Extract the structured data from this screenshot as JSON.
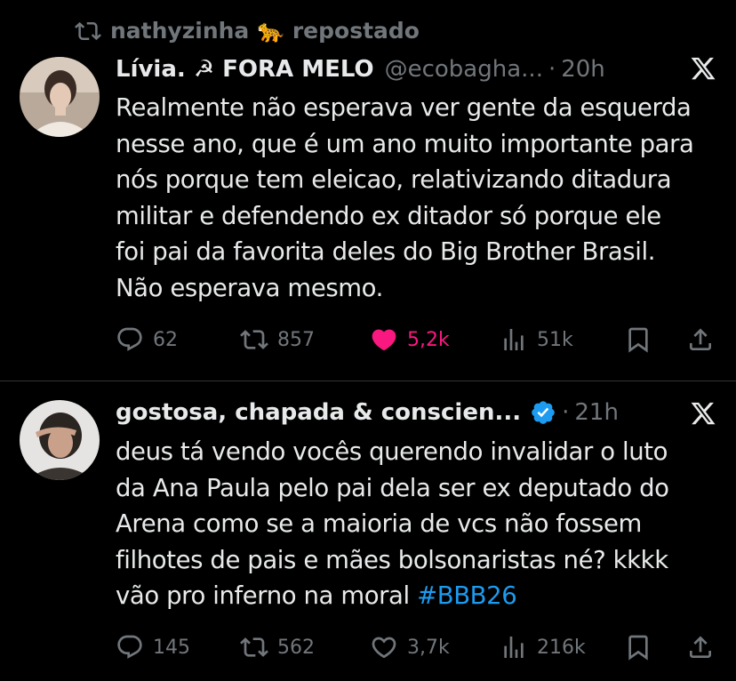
{
  "repost": {
    "label": "nathyzinha 🐆 repostado"
  },
  "tweets": [
    {
      "name": "Lívia. ☭ FORA MELO",
      "handle": "@ecobagha...",
      "dot": "·",
      "time": "20h",
      "text_lines": [
        "Realmente não esperava ver gente da esquerda",
        "nesse ano, que é um ano muito importante para",
        "nós porque tem eleicao, relativizando ditadura",
        "militar e defendendo ex ditador só porque ele",
        "foi pai da favorita deles do Big Brother Brasil.",
        "Não esperava mesmo."
      ],
      "replies": "62",
      "reposts": "857",
      "likes": "5,2k",
      "views": "51k",
      "liked": true
    },
    {
      "name": "gostosa, chapada & conscien...",
      "verified": true,
      "dot": "·",
      "time": "21h",
      "text_lines": [
        "deus tá vendo vocês querendo invalidar o luto",
        "da Ana Paula pelo pai dela ser ex deputado do",
        "Arena como se a maioria de vcs não fossem",
        "filhotes de pais e mães bolsonaristas né? kkkk",
        "vão pro inferno na moral"
      ],
      "hashtag": "#BBB26",
      "replies": "145",
      "reposts": "562",
      "likes": "3,7k",
      "views": "216k",
      "liked": false
    }
  ],
  "colors": {
    "background": "#000000",
    "text": "#e7e9ea",
    "muted": "#71767b",
    "accent": "#1d9bf0",
    "like": "#f91880",
    "divider": "#2f3336"
  }
}
